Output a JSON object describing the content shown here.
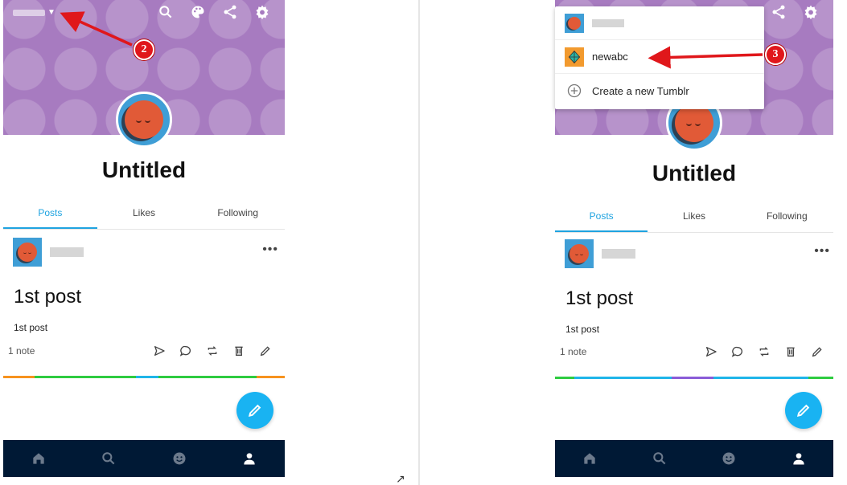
{
  "left_phone": {
    "title": "Untitled",
    "tabs": [
      {
        "label": "Posts",
        "active": true
      },
      {
        "label": "Likes",
        "active": false
      },
      {
        "label": "Following",
        "active": false
      }
    ],
    "post": {
      "title": "1st post",
      "body": "1st post",
      "notes": "1 note",
      "more": "•••"
    },
    "stripe_colors": [
      "#f7931e",
      "#2ecc40",
      "#2ecc40",
      "#1fb5e9",
      "#2ecc40",
      "#f7931e"
    ]
  },
  "right_phone": {
    "title": "Untitled",
    "tabs": [
      {
        "label": "Posts",
        "active": true
      },
      {
        "label": "Likes",
        "active": false
      },
      {
        "label": "Following",
        "active": false
      }
    ],
    "post": {
      "title": "1st post",
      "body": "1st post",
      "notes": "1 note",
      "more": "•••"
    },
    "stripe_colors": [
      "#2ecc40",
      "#1fb5e9",
      "#1fb5e9",
      "#8a5cd8",
      "#1fb5e9",
      "#2ecc40"
    ]
  },
  "dropdown": {
    "items": [
      {
        "label": "",
        "avatar": "blue",
        "blurred": true
      },
      {
        "label": "newabc",
        "avatar": "orange"
      },
      {
        "label": "Create a new Tumblr",
        "icon": "plus-circle-icon"
      }
    ]
  },
  "annotations": {
    "step_2": "2",
    "step_3": "3",
    "arrow_color": "#e0171b"
  },
  "colors": {
    "header_purple": "#a77bc0",
    "accent_blue": "#1fa3e0",
    "fab_blue": "#19b3f2",
    "nav_dark": "#001935"
  },
  "icons": {
    "header": [
      "search-icon",
      "palette-icon",
      "share-icon",
      "gear-icon"
    ],
    "actions": [
      "send-icon",
      "comment-icon",
      "reblog-icon",
      "trash-icon",
      "edit-icon"
    ],
    "nav": [
      "home-icon",
      "explore-icon",
      "messages-icon",
      "account-icon"
    ]
  },
  "corner_glyph": "↗"
}
